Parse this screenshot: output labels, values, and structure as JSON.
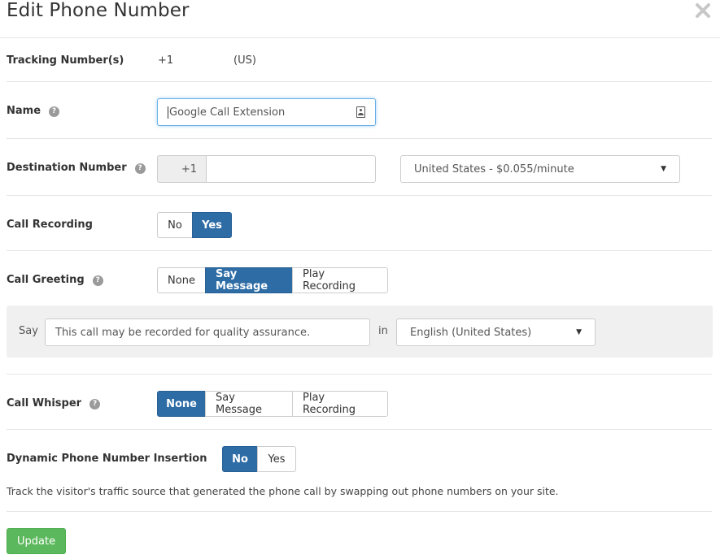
{
  "dialog": {
    "title": "Edit Phone Number"
  },
  "tracking": {
    "label": "Tracking Number(s)",
    "prefix": "+1",
    "country": "(US)"
  },
  "name": {
    "label": "Name",
    "help": "?",
    "value": "Google Call Extension"
  },
  "destination": {
    "label": "Destination Number",
    "help": "?",
    "country_code": "+1",
    "value": "",
    "rate_select": "United States - $0.055/minute"
  },
  "recording": {
    "label": "Call Recording",
    "options": [
      "No",
      "Yes"
    ],
    "selected": "Yes"
  },
  "greeting": {
    "label": "Call Greeting",
    "help": "?",
    "options": [
      "None",
      "Say Message",
      "Play Recording"
    ],
    "selected": "Say Message",
    "say_label": "Say",
    "message": "This call may be recorded for quality assurance.",
    "in_label": "in",
    "language": "English (United States)"
  },
  "whisper": {
    "label": "Call Whisper",
    "help": "?",
    "options": [
      "None",
      "Say Message",
      "Play Recording"
    ],
    "selected": "None"
  },
  "dni": {
    "label": "Dynamic Phone Number Insertion",
    "options": [
      "No",
      "Yes"
    ],
    "selected": "No",
    "description": "Track the visitor's traffic source that generated the phone call by swapping out phone numbers on your site."
  },
  "actions": {
    "update": "Update"
  },
  "colors": {
    "primary": "#2e6ca6",
    "success": "#5cb85c",
    "panel": "#f0f0f0"
  }
}
